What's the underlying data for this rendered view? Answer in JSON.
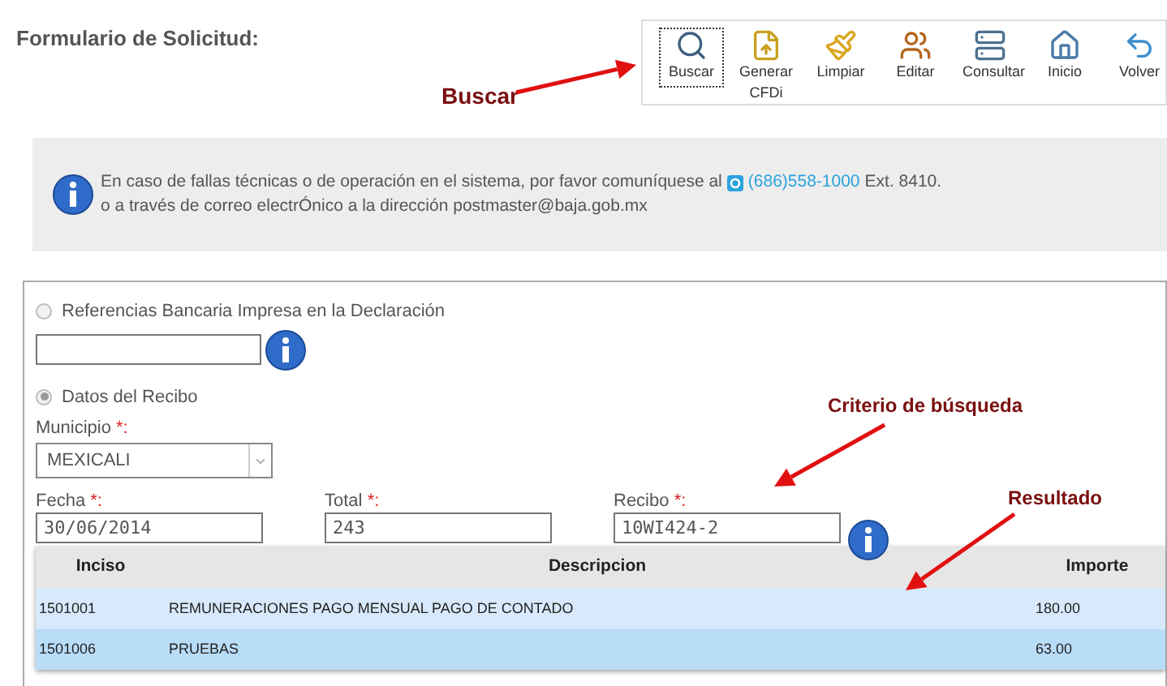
{
  "title": "Formulario de Solicitud:",
  "toolbar": [
    {
      "kind": "search",
      "label": "Buscar",
      "selected": true
    },
    {
      "kind": "cfdi",
      "label": "Generar CFDi",
      "selected": false
    },
    {
      "kind": "broom",
      "label": "Limpiar",
      "selected": false
    },
    {
      "kind": "users",
      "label": "Editar",
      "selected": false
    },
    {
      "kind": "server",
      "label": "Consultar",
      "selected": false
    },
    {
      "kind": "home",
      "label": "Inicio",
      "selected": false
    },
    {
      "kind": "back",
      "label": "Volver",
      "selected": false
    }
  ],
  "notice": {
    "before": "En caso de fallas técnicas o de operación en el sistema, por favor comuníquese al",
    "phone": "(686)558-1000",
    "after": "Ext. 8410.",
    "line2": "o a través de correo electrÓnico a la dirección postmaster@baja.gob.mx"
  },
  "options": [
    {
      "label": "Referencias Bancaria Impresa en la Declaración",
      "selected": false
    },
    {
      "label": "Datos del Recibo",
      "selected": true
    }
  ],
  "municipio": {
    "label": "Municipio",
    "required": "*:",
    "value": "MEXICALI"
  },
  "fields": [
    {
      "label": "Fecha",
      "required": "*:",
      "value": "30/06/2014"
    },
    {
      "label": "Total",
      "required": "*:",
      "value": "243"
    },
    {
      "label": "Recibo",
      "required": "*:",
      "value": "10WI424-2"
    }
  ],
  "table": {
    "columns": [
      "Inciso",
      "Descripcion",
      "Importe"
    ],
    "rows": [
      {
        "cells": [
          "1501001",
          "REMUNERACIONES PAGO MENSUAL PAGO DE CONTADO",
          "180.00"
        ],
        "selected": false
      },
      {
        "cells": [
          "1501006",
          "PRUEBAS",
          "63.00"
        ],
        "selected": true
      }
    ]
  },
  "annotations": [
    "Buscar",
    "Criterio de búsqueda",
    "Resultado"
  ]
}
